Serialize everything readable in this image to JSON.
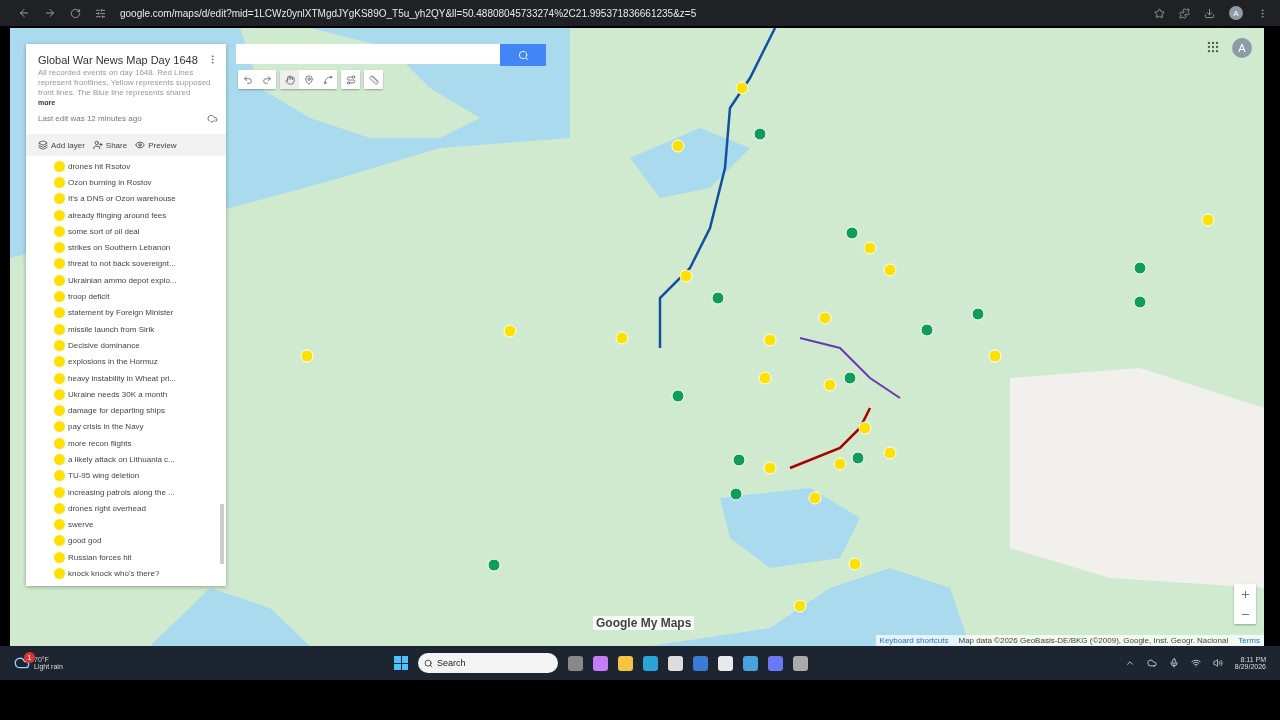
{
  "browser": {
    "url": "google.com/maps/d/edit?mid=1LCWz0ynlXTMgdJYgKS89O_T5u_yh2QY&ll=50.48808045733274%2C21.995371836661235&z=5",
    "profile": "A"
  },
  "panel": {
    "title": "Global War News Map Day 1648",
    "description": "All recorded events on day 1648. Red Lines represent frontlines, Yellow represents supposed front lines. The Blue line represents shared",
    "more": "more",
    "last_edit": "Last edit was 12 minutes ago",
    "actions": [
      "Add layer",
      "Share",
      "Preview"
    ],
    "items": [
      {
        "label": "drones hit Rsotov"
      },
      {
        "label": "Ozon burning in Rostov"
      },
      {
        "label": "It's a DNS or Ozon warehouse"
      },
      {
        "label": "already flinging around fees"
      },
      {
        "label": "some sort of oil deal"
      },
      {
        "label": "strikes on Southern Lebanon"
      },
      {
        "label": "threat to not back sovereignt..."
      },
      {
        "label": "Ukrainian ammo depot explo..."
      },
      {
        "label": "troop deficit"
      },
      {
        "label": "statement by Foreign Minister"
      },
      {
        "label": "missile launch from Sirik"
      },
      {
        "label": "Decisive dominance"
      },
      {
        "label": "explosions in the Hormuz"
      },
      {
        "label": "heavy instability in Wheat pri..."
      },
      {
        "label": "Ukraine needs 30K a month"
      },
      {
        "label": "damage for departing ships"
      },
      {
        "label": "pay crisis in the Navy"
      },
      {
        "label": "more recon flights"
      },
      {
        "label": "a likely attack on Lithuania c..."
      },
      {
        "label": "TU-95 wing deletion"
      },
      {
        "label": "increasing patrols along the ..."
      },
      {
        "label": "drones right overhead"
      },
      {
        "label": "swerve"
      },
      {
        "label": "good god"
      },
      {
        "label": "Russian forces hit"
      },
      {
        "label": "knock knock who's there?"
      }
    ]
  },
  "map": {
    "logo": "Google My Maps",
    "footer": [
      "Keyboard shortcuts",
      "Map data ©2026 GeoBasis-DE/BKG (©2009), Google, Inst. Geogr. Nacional",
      "Terms"
    ],
    "account": "A"
  },
  "taskbar": {
    "weather_temp": "70°F",
    "weather_desc": "Light rain",
    "weather_badge": "1",
    "search": "Search",
    "time": "8:11 PM",
    "date": "8/29/2026"
  }
}
